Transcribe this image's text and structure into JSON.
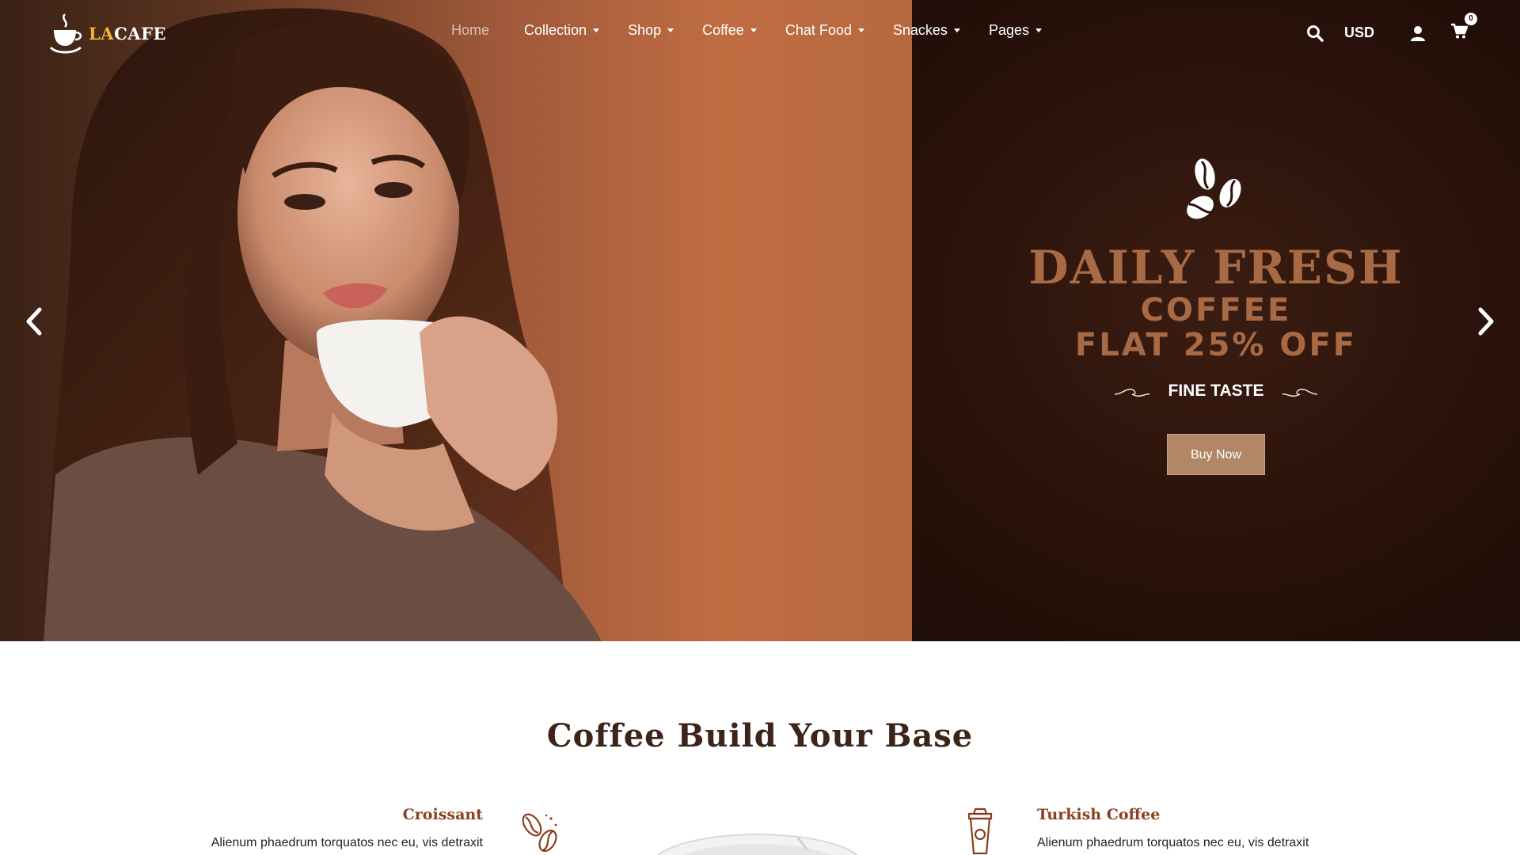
{
  "brand": {
    "prefix": "LA",
    "name": "CAFE"
  },
  "nav": {
    "items": [
      {
        "label": "Home",
        "dropdown": false
      },
      {
        "label": "Collection",
        "dropdown": true
      },
      {
        "label": "Shop",
        "dropdown": true
      },
      {
        "label": "Coffee",
        "dropdown": true
      },
      {
        "label": "Chat Food",
        "dropdown": true
      },
      {
        "label": "Snackes",
        "dropdown": true
      },
      {
        "label": "Pages",
        "dropdown": true
      }
    ]
  },
  "tools": {
    "currency": "USD",
    "cart_count": "0"
  },
  "hero": {
    "headline": "DAILY FRESH",
    "line1": "COFFEE",
    "line2": "FLAT 25% OFF",
    "tagline": "FINE TASTE",
    "cta": "Buy Now"
  },
  "section": {
    "title": "Coffee Build Your Base",
    "left": {
      "title": "Croissant",
      "text": "Alienum phaedrum torquatos nec eu, vis detraxit"
    },
    "right": {
      "title": "Turkish Coffee",
      "text": "Alienum phaedrum torquatos nec eu, vis detraxit"
    }
  },
  "colors": {
    "accent": "#a86a45",
    "button": "#b18767",
    "heading": "#3c2419",
    "feature_title": "#8a3f1e"
  }
}
